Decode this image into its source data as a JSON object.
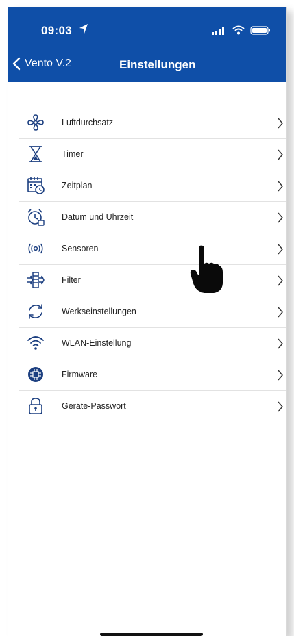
{
  "status_bar": {
    "time": "09:03",
    "icons": [
      "location-arrow-icon",
      "signal-icon",
      "wifi-icon",
      "battery-icon"
    ]
  },
  "nav": {
    "back_label": "Vento V.2",
    "title": "Einstellungen"
  },
  "menu": {
    "items": [
      {
        "label": "Luftdurchsatz",
        "icon": "fan-icon"
      },
      {
        "label": "Timer",
        "icon": "hourglass-icon"
      },
      {
        "label": "Zeitplan",
        "icon": "calendar-clock-icon"
      },
      {
        "label": "Datum und Uhrzeit",
        "icon": "alarm-clock-icon"
      },
      {
        "label": "Sensoren",
        "icon": "sensor-waves-icon"
      },
      {
        "label": "Filter",
        "icon": "filter-icon"
      },
      {
        "label": "Werkseinstellungen",
        "icon": "reset-arrows-icon"
      },
      {
        "label": "WLAN-Einstellung",
        "icon": "wifi-icon"
      },
      {
        "label": "Firmware",
        "icon": "chip-globe-icon"
      },
      {
        "label": "Geräte-Passwort",
        "icon": "lock-icon"
      }
    ]
  },
  "colors": {
    "header": "#0f4fa8",
    "text": "#222222",
    "divider": "#e2e2e2"
  }
}
